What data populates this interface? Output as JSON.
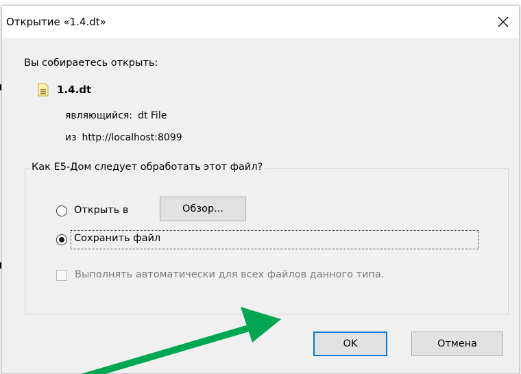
{
  "background": {
    "glyph_a": "о",
    "glyph_b": "е"
  },
  "dialog": {
    "title": "Открытие «1.4.dt»",
    "prompt": "Вы собираетесь открыть:",
    "file": {
      "name": "1.4.dt",
      "type_label": "являющийся:",
      "type_value": "dt File",
      "from_label": "из",
      "from_value": "http://localhost:8099"
    },
    "group_title": "Как E5-Дом следует обработать этот файл?",
    "options": {
      "open_with_label": "Открыть в",
      "open_with_selected": false,
      "browse_button": "Обзор...",
      "save_label": "Сохранить файл",
      "save_selected": true
    },
    "auto_checkbox": {
      "label": "Выполнять автоматически для всех файлов данного типа.",
      "checked": false,
      "enabled": false
    },
    "buttons": {
      "ok": "OK",
      "cancel": "Отмена"
    }
  },
  "colors": {
    "annotation_arrow": "#00a651",
    "default_button_border": "#0078d7"
  }
}
